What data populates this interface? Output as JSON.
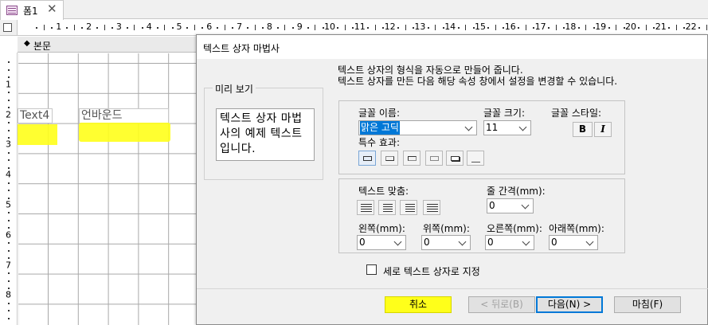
{
  "document_tab": {
    "label": "폼1",
    "close_glyph": "✕"
  },
  "ruler": {
    "marks": [
      "1",
      "2",
      "3",
      "4",
      "5",
      "6",
      "7",
      "8",
      "9",
      "10",
      "11",
      "12",
      "13",
      "14",
      "15",
      "16",
      "17",
      "18",
      "19",
      "20",
      "21",
      "22"
    ]
  },
  "vertical_ruler": {
    "marks": [
      "1",
      "2",
      "3",
      "4",
      "5",
      "6",
      "7",
      "8"
    ]
  },
  "form_section": {
    "label": "본문",
    "arrow": "◆"
  },
  "form_controls": {
    "text_box_label": "Text4",
    "label_text": "언바운드"
  },
  "dialog": {
    "title": "텍스트 상자 마법사",
    "description_line1": "텍스트 상자의 형식을 자동으로 만들어 줍니다.",
    "description_line2": "텍스트 상자를 만든 다음 해당 속성 창에서 설정을 변경할 수 있습니다.",
    "preview": {
      "group_label": "미리 보기",
      "sample_line1": "텍스트 상자 마법",
      "sample_line2": "사의 예제 텍스트",
      "sample_line3": "입니다."
    },
    "font": {
      "name_label": "글꼴 이름:",
      "name_value": "맑은 고딕",
      "size_label": "글꼴 크기:",
      "size_value": "11",
      "style_label": "글꼴 스타일:",
      "bold_glyph": "B",
      "italic_glyph": "I",
      "effects_label": "특수 효과:"
    },
    "layout": {
      "align_label": "텍스트 맞춤:",
      "line_spacing_label": "줄 간격(mm):",
      "line_spacing_value": "0",
      "left_label": "왼쪽(mm):",
      "left_value": "0",
      "top_label": "위쪽(mm):",
      "top_value": "0",
      "right_label": "오른쪽(mm):",
      "right_value": "0",
      "bottom_label": "아래쪽(mm):",
      "bottom_value": "0"
    },
    "vertical_text_label": "세로 텍스트 상자로 지정",
    "buttons": {
      "cancel": "취소",
      "back": "< 뒤로(B)",
      "next": "다음(N) >",
      "finish": "마침(F)"
    }
  },
  "colors": {
    "highlight": "#ffff1a",
    "selection": "#0078d7"
  }
}
